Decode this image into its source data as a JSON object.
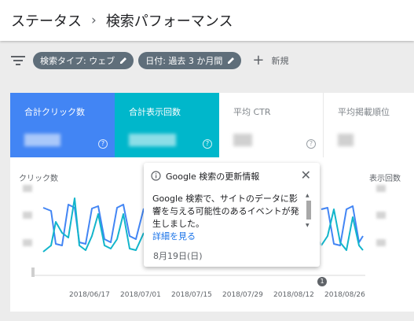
{
  "header": {
    "parent": "ステータス",
    "separator": "›",
    "title": "検索パフォーマンス"
  },
  "filters": {
    "chips": [
      {
        "label": "検索タイプ: ウェブ"
      },
      {
        "label": "日付: 過去 3 か月間"
      }
    ],
    "new_label": "新規"
  },
  "metrics": [
    {
      "label": "合計クリック数",
      "value": "",
      "color": "#4285f4"
    },
    {
      "label": "合計表示回数",
      "value": "",
      "color": "#00b7cb"
    },
    {
      "label": "平均 CTR",
      "value": ""
    },
    {
      "label": "平均掲載順位",
      "value": ""
    }
  ],
  "chart": {
    "left_axis_label": "クリック数",
    "right_axis_label": "表示回数",
    "x_labels": [
      "2018/06/17",
      "2018/07/01",
      "2018/07/15",
      "2018/07/29",
      "2018/08/12",
      "2018/08/26"
    ],
    "annotation_marker": "1",
    "colors": {
      "clicks": "#4285f4",
      "impressions": "#12b5cb"
    }
  },
  "popup": {
    "title": "Google 検索の更新情報",
    "body": "Google 検索で、サイトのデータに影響を与える可能性のあるイベントが発生しました。",
    "link": "詳細を見る",
    "date": "8月19日(日)"
  }
}
